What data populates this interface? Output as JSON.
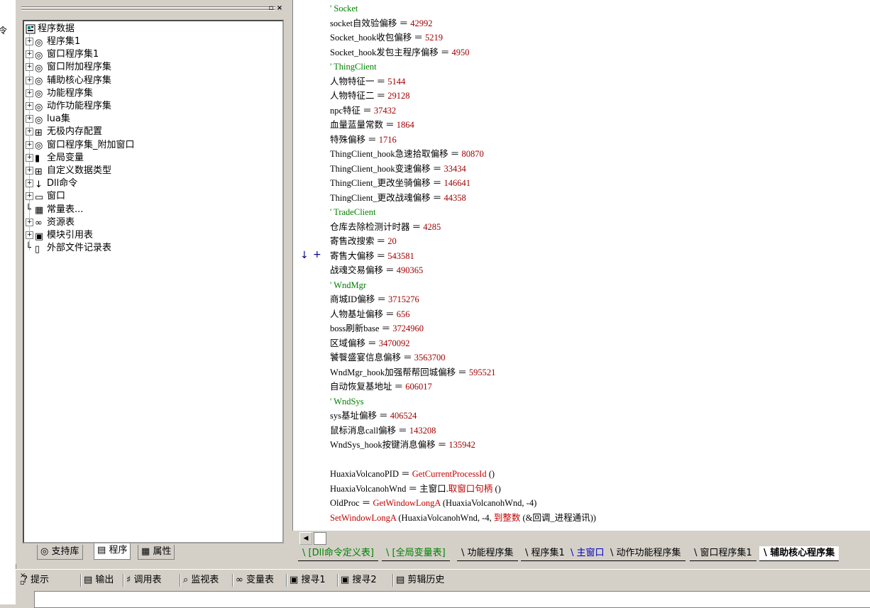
{
  "left_strip": {
    "cut_text": "令"
  },
  "tree": {
    "root": "程序数据",
    "items": [
      {
        "label": "程序集1",
        "expand": "+"
      },
      {
        "label": "窗口程序集1",
        "expand": "+"
      },
      {
        "label": "窗口附加程序集",
        "expand": "+"
      },
      {
        "label": "辅助核心程序集",
        "expand": "+"
      },
      {
        "label": "功能程序集",
        "expand": "+"
      },
      {
        "label": "动作功能程序集",
        "expand": "+"
      },
      {
        "label": "lua集",
        "expand": "+"
      },
      {
        "label": "无极内存配置",
        "expand": "+"
      },
      {
        "label": "窗口程序集_附加窗口",
        "expand": "+"
      },
      {
        "label": "全局变量",
        "expand": "+"
      },
      {
        "label": "自定义数据类型",
        "expand": "+"
      },
      {
        "label": "Dll命令",
        "expand": "+"
      },
      {
        "label": "窗口",
        "expand": "+"
      },
      {
        "label": "常量表...",
        "expand": ""
      },
      {
        "label": "资源表",
        "expand": "+"
      },
      {
        "label": "模块引用表",
        "expand": "+"
      },
      {
        "label": "外部文件记录表",
        "expand": ""
      }
    ]
  },
  "left_tabs": [
    "支持库",
    "程序",
    "属性"
  ],
  "code": [
    {
      "t": "comment",
      "text": "' Socket"
    },
    {
      "t": "assign",
      "name": "socket自效验偏移",
      "value": "42992"
    },
    {
      "t": "assign",
      "name": "Socket_hook收包偏移",
      "value": "5219"
    },
    {
      "t": "assign",
      "name": "Socket_hook发包主程序偏移",
      "value": "4950"
    },
    {
      "t": "comment",
      "text": "' ThingClient"
    },
    {
      "t": "assign",
      "name": "人物特征一",
      "value": "5144"
    },
    {
      "t": "assign",
      "name": "人物特征二",
      "value": "29128"
    },
    {
      "t": "assign",
      "name": "npc特征",
      "value": "37432"
    },
    {
      "t": "assign",
      "name": "血量蓝量常数",
      "value": "1864"
    },
    {
      "t": "assign",
      "name": "特殊偏移",
      "value": "1716"
    },
    {
      "t": "assign",
      "name": "ThingClient_hook急速拾取偏移",
      "value": "80870"
    },
    {
      "t": "assign",
      "name": "ThingClient_hook变速偏移",
      "value": "33434"
    },
    {
      "t": "assign",
      "name": "ThingClient_更改坐骑偏移",
      "value": "146641"
    },
    {
      "t": "assign",
      "name": "ThingClient_更改战魂偏移",
      "value": "44358"
    },
    {
      "t": "comment",
      "text": "' TradeClient"
    },
    {
      "t": "assign",
      "name": "仓库去除检测计时器",
      "value": "4285"
    },
    {
      "t": "assign",
      "name": "寄售改搜索",
      "value": "20"
    },
    {
      "t": "assign",
      "name": "寄售大偏移",
      "value": "543581"
    },
    {
      "t": "assign",
      "name": "战魂交易偏移",
      "value": "490365"
    },
    {
      "t": "comment",
      "text": "' WndMgr"
    },
    {
      "t": "assign",
      "name": "商城ID偏移",
      "value": "3715276"
    },
    {
      "t": "assign",
      "name": "人物基址偏移",
      "value": "656"
    },
    {
      "t": "assign",
      "name": "boss刷新base",
      "value": "3724960"
    },
    {
      "t": "assign",
      "name": "区域偏移",
      "value": "3470092"
    },
    {
      "t": "assign",
      "name": "饕餮盛宴信息偏移",
      "value": "3563700"
    },
    {
      "t": "assign",
      "name": "WndMgr_hook加强帮帮回城偏移",
      "value": "595521"
    },
    {
      "t": "assign",
      "name": "自动恢复基地址",
      "value": "606017"
    },
    {
      "t": "comment",
      "text": "' WndSys"
    },
    {
      "t": "assign",
      "name": "sys基址偏移",
      "value": "406524"
    },
    {
      "t": "assign",
      "name": "鼠标消息call偏移",
      "value": "143208"
    },
    {
      "t": "assign",
      "name": "WndSys_hook按键消息偏移",
      "value": "135942"
    },
    {
      "t": "blank"
    },
    {
      "t": "call",
      "name": "HuaxiaVolcanoPID",
      "fn": "GetCurrentProcessId",
      "args": " ()"
    },
    {
      "t": "call2",
      "name": "HuaxiaVolcanohWnd",
      "pre": "主窗口.",
      "fn": "取窗口句柄",
      "args": " ()"
    },
    {
      "t": "call",
      "name": "OldProc",
      "fn": "GetWindowLongA",
      "args": " (HuaxiaVolcanohWnd, -4)"
    },
    {
      "t": "stmt",
      "fn": "SetWindowLongA",
      "args1": " (HuaxiaVolcanohWnd, -4, ",
      "fn2": "到整数",
      "args2": " (&回调_进程通讯))"
    }
  ],
  "gutter_markers": [
    "↓",
    "+"
  ],
  "code_tabs": [
    {
      "label": "[Dll命令定义表]",
      "style": "green"
    },
    {
      "label": "[全局变量表]",
      "style": "green"
    },
    {
      "label": "功能程序集",
      "style": ""
    },
    {
      "label": "程序集1",
      "style": ""
    },
    {
      "label": "主窗口",
      "style": "blue"
    },
    {
      "label": "动作功能程序集",
      "style": ""
    },
    {
      "label": "窗口程序集1",
      "style": ""
    },
    {
      "label": "辅助核心程序集",
      "style": "active"
    }
  ],
  "output_tabs": [
    "提示",
    "输出",
    "调用表",
    "监视表",
    "变量表",
    "搜寻1",
    "搜寻2",
    "剪辑历史"
  ],
  "colors": {
    "comment": "#008000",
    "number": "#a00000",
    "function": "#c00000",
    "tab_blue": "#0000c0"
  }
}
